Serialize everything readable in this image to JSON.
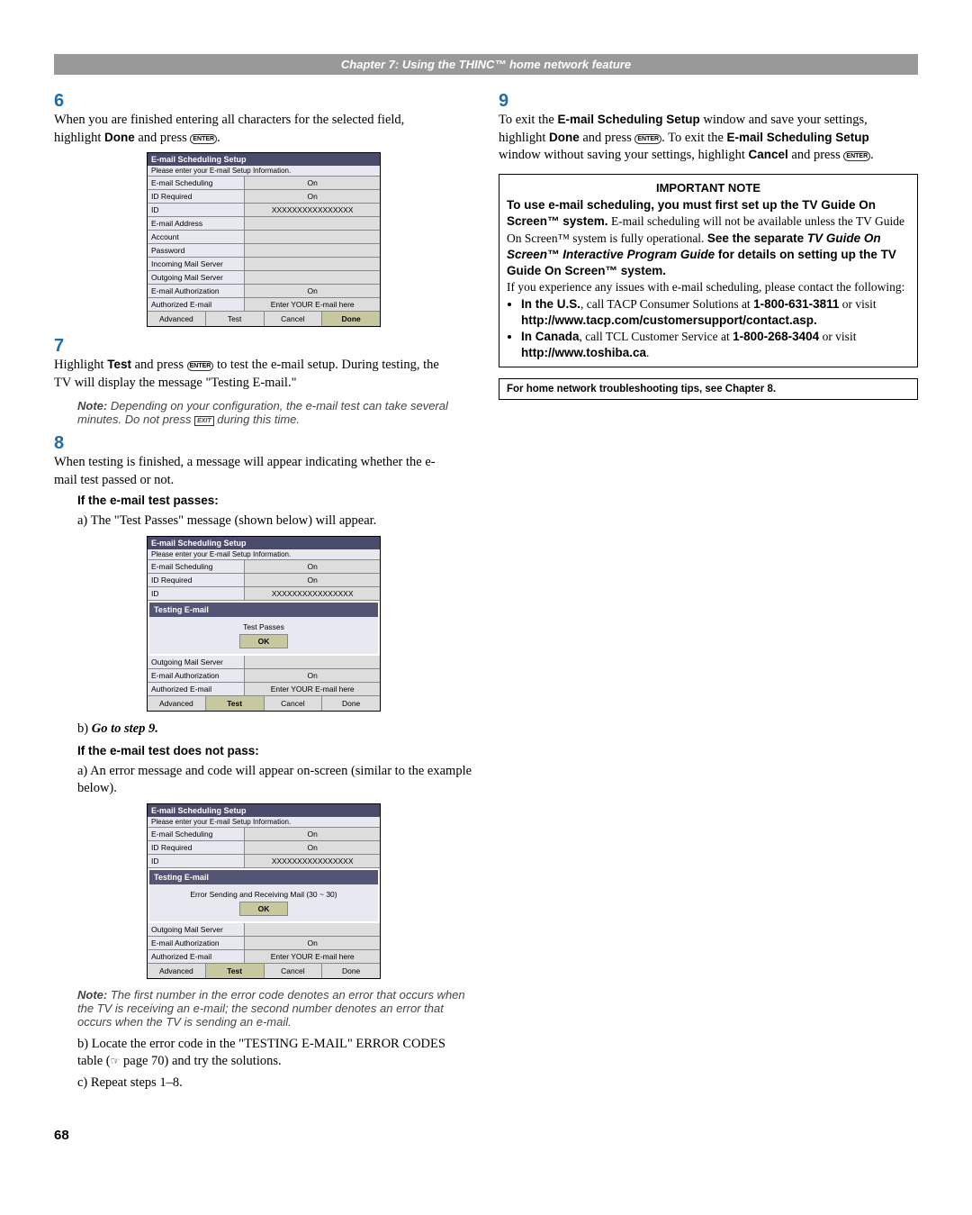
{
  "page_number": "68",
  "header": "Chapter 7: Using the THINC™ home network feature",
  "left": {
    "step6": {
      "num": "6",
      "text_1": "When you are finished entering all characters for the selected field, highlight ",
      "done": "Done",
      "text_2": " and press ",
      "enter": "ENTER",
      "text_3": "."
    },
    "setup1": {
      "title": "E-mail Scheduling Setup",
      "subtitle": "Please enter your E-mail Setup Information.",
      "rows": [
        {
          "label": "E-mail Scheduling",
          "value": "On"
        },
        {
          "label": "ID Required",
          "value": "On"
        },
        {
          "label": "ID",
          "value": "XXXXXXXXXXXXXXXX"
        },
        {
          "label": "E-mail Address",
          "value": ""
        },
        {
          "label": "Account",
          "value": ""
        },
        {
          "label": "Password",
          "value": ""
        },
        {
          "label": "Incoming Mail Server",
          "value": ""
        },
        {
          "label": "Outgoing Mail Server",
          "value": ""
        },
        {
          "label": "E-mail Authorization",
          "value": "On"
        },
        {
          "label": "Authorized E-mail",
          "value": "Enter YOUR E-mail here"
        }
      ],
      "buttons": [
        "Advanced",
        "Test",
        "Cancel",
        "Done"
      ],
      "highlight_index": 3
    },
    "step7": {
      "num": "7",
      "text_1": "Highlight ",
      "test": "Test",
      "text_2": " and press ",
      "enter": "ENTER",
      "text_3": " to test the e-mail setup. During testing, the TV will display the message \"Testing E-mail.\""
    },
    "note1": {
      "label": "Note:",
      "text_1": " Depending on your configuration, the e-mail test can take several minutes. Do not press ",
      "exit": "EXIT",
      "text_2": " during this time."
    },
    "step8": {
      "num": "8",
      "text": "When testing is finished, a message will appear indicating whether the e-mail test passed or not."
    },
    "pass_heading": "If the e-mail test passes:",
    "pass_a": "a) The \"Test Passes\" message (shown below) will appear.",
    "setup2": {
      "title": "E-mail Scheduling Setup",
      "subtitle": "Please enter your E-mail Setup Information.",
      "rows_top": [
        {
          "label": "E-mail Scheduling",
          "value": "On"
        },
        {
          "label": "ID Required",
          "value": "On"
        },
        {
          "label": "ID",
          "value": "XXXXXXXXXXXXXXXX"
        }
      ],
      "modal_title": "Testing E-mail",
      "modal_text": "Test Passes",
      "modal_btn": "OK",
      "rows_bottom": [
        {
          "label": "Outgoing Mail Server",
          "value": ""
        },
        {
          "label": "E-mail Authorization",
          "value": "On"
        },
        {
          "label": "Authorized E-mail",
          "value": "Enter YOUR E-mail here"
        }
      ],
      "buttons": [
        "Advanced",
        "Test",
        "Cancel",
        "Done"
      ],
      "highlight_index": 1
    },
    "pass_b": "b) Go to step 9.",
    "fail_heading": "If the e-mail test does not pass:",
    "fail_a": "a) An error message and code will appear on-screen (similar to the example below).",
    "setup3": {
      "title": "E-mail Scheduling Setup",
      "subtitle": "Please enter your E-mail Setup Information.",
      "rows_top": [
        {
          "label": "E-mail Scheduling",
          "value": "On"
        },
        {
          "label": "ID Required",
          "value": "On"
        },
        {
          "label": "ID",
          "value": "XXXXXXXXXXXXXXXX"
        }
      ],
      "modal_title": "Testing E-mail",
      "modal_text": "Error Sending and Receiving Mail (30 ~ 30)",
      "modal_btn": "OK",
      "rows_bottom": [
        {
          "label": "Outgoing Mail Server",
          "value": ""
        },
        {
          "label": "E-mail Authorization",
          "value": "On"
        },
        {
          "label": "Authorized E-mail",
          "value": "Enter YOUR E-mail here"
        }
      ],
      "buttons": [
        "Advanced",
        "Test",
        "Cancel",
        "Done"
      ],
      "highlight_index": 1
    },
    "note2": {
      "label": "Note:",
      "text": " The first number in the error code denotes an error that occurs when the TV is receiving an e-mail; the second number denotes an error that occurs when the TV is sending an e-mail."
    },
    "fail_b_1": "b) Locate the error code in the \"TESTING E-MAIL\" ERROR CODES table (",
    "fail_b_hand": "☞",
    "fail_b_2": " page 70) and try the solutions.",
    "fail_c": "c) Repeat steps 1–8."
  },
  "right": {
    "step9": {
      "num": "9",
      "text_1": "To exit the ",
      "bold1": "E-mail Scheduling Setup",
      "text_2": " window and save your settings, highlight ",
      "done": "Done",
      "text_3": " and press ",
      "enter": "ENTER",
      "text_4": ". To exit the ",
      "bold2": "E-mail Scheduling Setup",
      "text_5": " window without saving your settings, highlight ",
      "cancel": "Cancel",
      "text_6": " and press ",
      "text_7": "."
    },
    "important": {
      "title": "IMPORTANT NOTE",
      "p1_bold": "To use e-mail scheduling, you must first set up the TV Guide On Screen™ system.",
      "p1_rest": " E-mail scheduling will not be available unless the TV Guide On Screen™ system is fully operational. ",
      "p1_see": "See the separate ",
      "p1_guide": "TV Guide On Screen™ Interactive Program Guide",
      "p1_details": " for details on setting up the TV Guide On Screen™ system.",
      "p2": "If you experience any issues with e-mail scheduling, please contact the following:",
      "bullet1_a": "In the U.S.",
      "bullet1_b": ", call TACP Consumer Solutions at ",
      "bullet1_c": "1-800-631-3811",
      "bullet1_d": " or visit ",
      "bullet1_e": "http://www.tacp.com/customersupport/contact.asp.",
      "bullet2_a": "In Canada",
      "bullet2_b": ", call TCL Customer Service at ",
      "bullet2_c": "1-800-268-3404",
      "bullet2_d": " or visit ",
      "bullet2_e": "http://www.toshiba.ca",
      "bullet2_f": "."
    },
    "tips": "For home network troubleshooting tips, see Chapter 8."
  }
}
